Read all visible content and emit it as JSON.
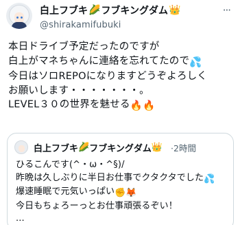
{
  "author": {
    "display_name": "白上フブキ",
    "community": "フブキングダム",
    "handle": "@shirakamifubuki"
  },
  "icons": {
    "corn": "🌽",
    "crown": "👑",
    "sweat": "💦",
    "fire": "🔥",
    "fist": "✊",
    "fox": "🦊"
  },
  "tweet": {
    "lines": [
      "本日ドライブ予定だったのですが",
      "白上がマネちゃんに連絡を忘れてたので",
      "今日はソロREPOになりますどうぞよろしく",
      "お願いします・・・・・・・。",
      "LEVEL３０の世界を魅せる"
    ]
  },
  "quote": {
    "display_name": "白上フブキ",
    "community": "フブキングダム",
    "separator": "·",
    "time": "2時間",
    "lines": [
      "ひるこんです(^・ω・^§)/",
      "昨晩は久しぶりに半日お仕事でクタクタでした",
      "爆速睡眠で元気いっぱい",
      "今日もちょろーっとお仕事頑張るぞい！",
      "..."
    ]
  },
  "more_label": "···"
}
